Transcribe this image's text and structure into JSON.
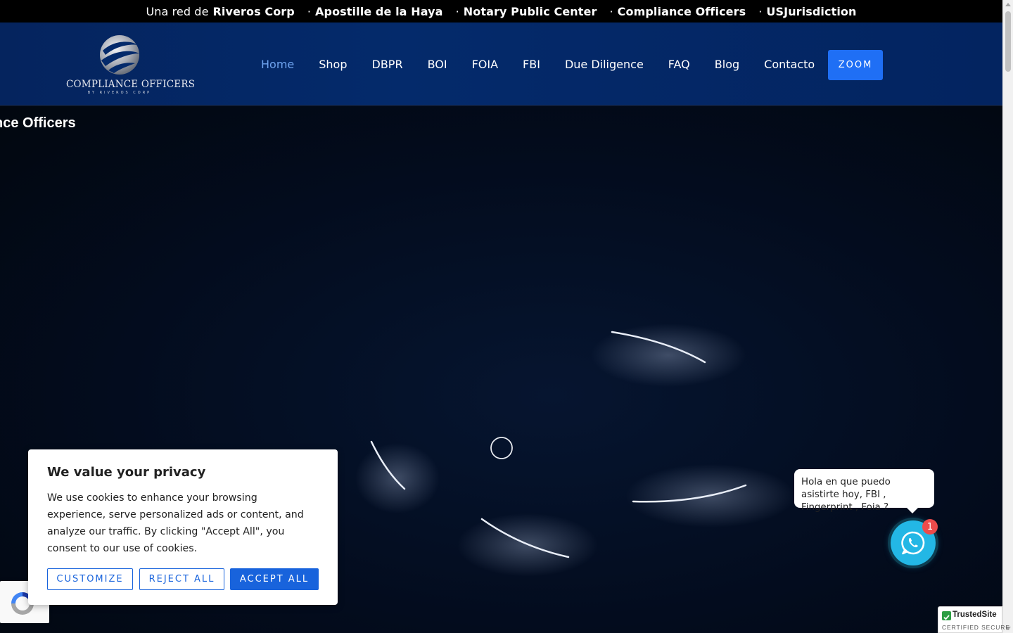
{
  "topbar": {
    "intro": "Una red de",
    "brand": "Riveros Corp",
    "links": [
      "Apostille de la Haya",
      "Notary Public Center",
      "Compliance Officers",
      "USJurisdiction"
    ]
  },
  "logo": {
    "title": "COMPLIANCE OFFICERS",
    "subtitle": "BY RIVEROS CORP"
  },
  "nav": {
    "items": [
      "Home",
      "Shop",
      "DBPR",
      "BOI",
      "FOIA",
      "FBI",
      "Due Diligence",
      "FAQ",
      "Blog",
      "Contacto"
    ],
    "active": "Home",
    "zoom_label": "ZOOM"
  },
  "hero": {
    "title_fragment": "nce Officers"
  },
  "cookie": {
    "title": "We value your privacy",
    "body": "We use cookies to enhance your browsing experience, serve personalized ads or content, and analyze our traffic. By clicking \"Accept All\", you consent to our use of cookies.",
    "customize": "CUSTOMIZE",
    "reject": "REJECT ALL",
    "accept": "ACCEPT ALL",
    "accent": "#1863dc"
  },
  "whatsapp": {
    "message": "Hola en que puedo asistirte hoy, FBI , Fingerprint , Foia ?",
    "badge": "1",
    "color": "#23b7e5"
  },
  "trusted": {
    "name": "TrustedSite",
    "tagline": "CERTIFIED SECURE"
  },
  "colors": {
    "header_bg": "#042a6b",
    "nav_active": "#6fa4f0",
    "zoom_btn": "#1f6ff5"
  }
}
